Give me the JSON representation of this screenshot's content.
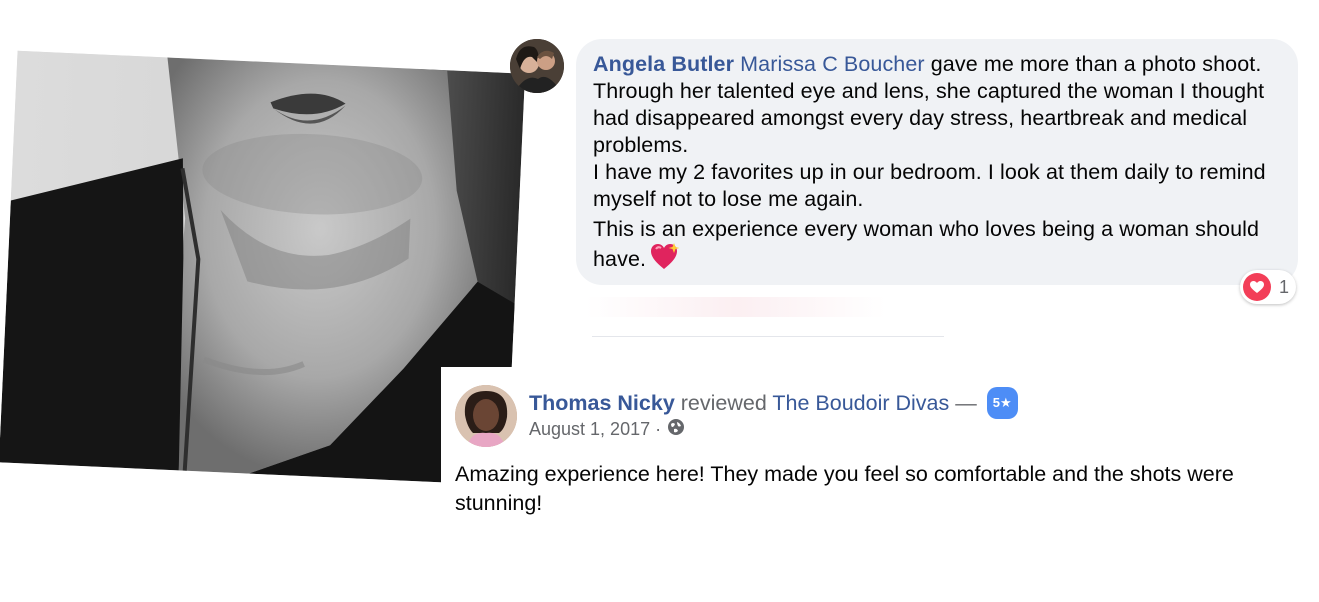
{
  "comment": {
    "author": "Angela Butler",
    "mention": "Marissa C Boucher",
    "paragraph1": "gave me more than a photo shoot. Through her talented eye and lens, she captured the woman I thought had disappeared amongst every day stress, heartbreak and medical problems.",
    "paragraph2": "I have my 2 favorites up in our bedroom. I look at them daily to remind myself not to lose me again.",
    "paragraph3": "This is an experience every woman who loves being a woman should have.",
    "emoji_icon": "sparkling-heart-icon",
    "reaction": {
      "icon": "love-reaction-icon",
      "count": "1",
      "color": "#f33e58"
    }
  },
  "review": {
    "reviewer": "Thomas Nicky",
    "verb": "reviewed",
    "page": "The Boudoir Divas",
    "dash": "—",
    "rating": "5★",
    "date": "August 1, 2017 ·",
    "privacy_icon": "globe-icon",
    "body": "Amazing experience here! They made you feel so comfortable and the shots were stunning!"
  },
  "colors": {
    "link_blue": "#385898",
    "bubble_bg": "#f0f2f5",
    "meta_gray": "#65676b",
    "rating_blue": "#4d8df6"
  }
}
